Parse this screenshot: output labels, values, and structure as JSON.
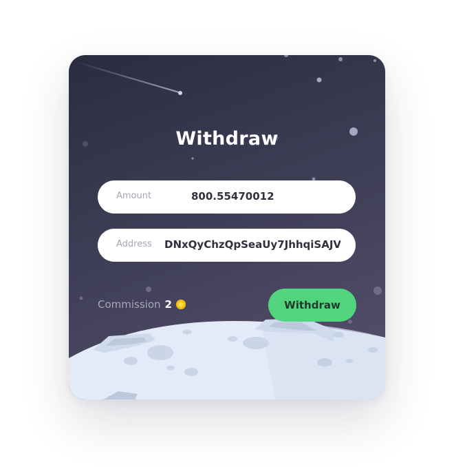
{
  "dialog": {
    "title": "Withdraw"
  },
  "amount": {
    "label": "Amount",
    "value": "800.55470012"
  },
  "address": {
    "label": "Address",
    "value": "DNxQyChzQpSeaUy7JhhqiSAJVa..."
  },
  "commission": {
    "label": "Commission",
    "value": "2",
    "icon": "coin-icon",
    "icon_color": "#f7cc1c"
  },
  "actions": {
    "withdraw_label": "Withdraw",
    "withdraw_color": "#52d57e"
  }
}
